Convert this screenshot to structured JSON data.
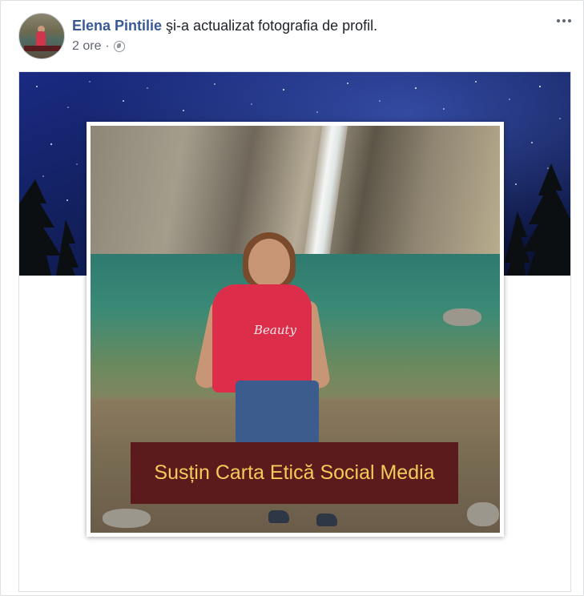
{
  "post": {
    "author": "Elena Pintilie",
    "action": " şi-a actualizat fotografia de profil.",
    "time": "2 ore",
    "separator": "·",
    "audience_icon": "globe-icon",
    "menu_icon": "more-options-icon"
  },
  "profile_photo": {
    "frame_text": "Susțin Carta Etică Social Media",
    "shirt_text": "Beauty"
  },
  "colors": {
    "author_link": "#385898",
    "banner_bg": "#5b1b1d",
    "banner_text": "#f3cb5a",
    "cover_sky": "#1a2a82"
  }
}
